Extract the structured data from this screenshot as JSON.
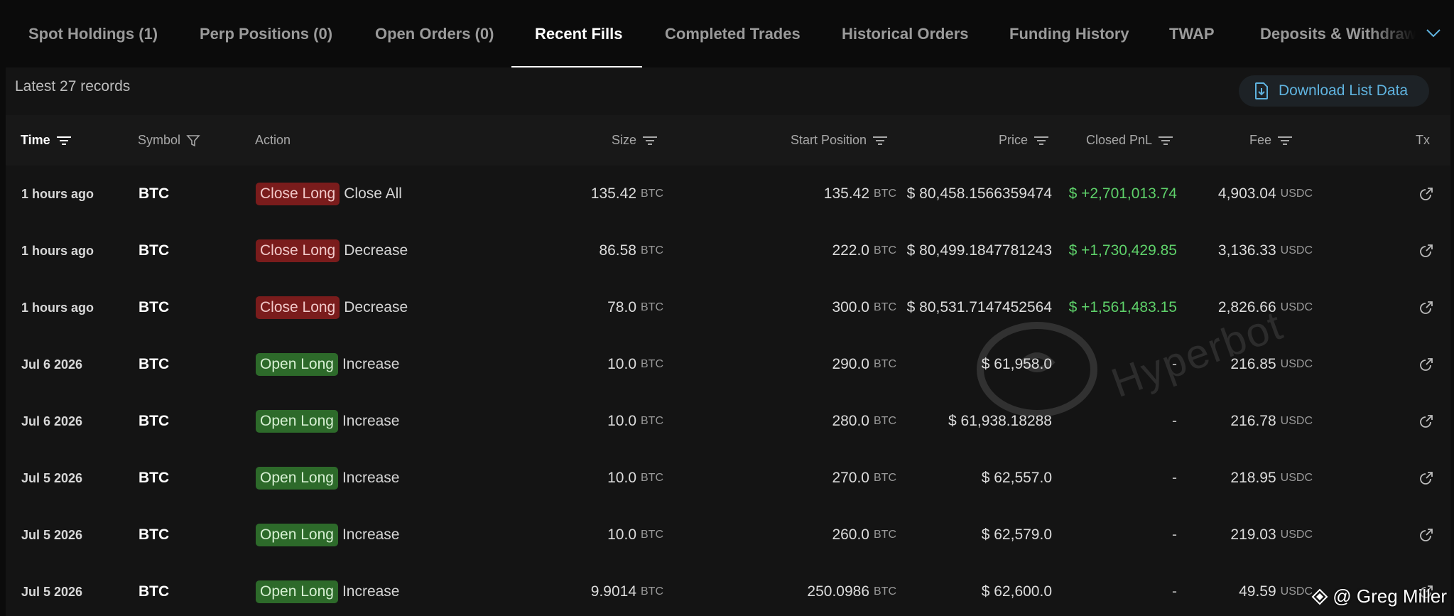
{
  "tabs": [
    {
      "label": "Spot Holdings (1)",
      "active": false
    },
    {
      "label": "Perp Positions (0)",
      "active": false
    },
    {
      "label": "Open Orders (0)",
      "active": false
    },
    {
      "label": "Recent Fills",
      "active": true
    },
    {
      "label": "Completed Trades",
      "active": false
    },
    {
      "label": "Historical Orders",
      "active": false
    },
    {
      "label": "Funding History",
      "active": false
    },
    {
      "label": "TWAP",
      "active": false
    },
    {
      "label": "Deposits & Withdraw",
      "active": false
    }
  ],
  "toolbar": {
    "records_text": "Latest 27 records",
    "download_label": "Download List Data"
  },
  "columns": {
    "time": "Time",
    "symbol": "Symbol",
    "action": "Action",
    "size": "Size",
    "start_position": "Start Position",
    "price": "Price",
    "closed_pnl": "Closed PnL",
    "fee": "Fee",
    "tx": "Tx"
  },
  "rows": [
    {
      "time": "1 hours ago",
      "symbol": "BTC",
      "action_badge": "Close Long",
      "action_type": "close",
      "action_detail": "Close All",
      "size": "135.42",
      "size_unit": "BTC",
      "start": "135.42",
      "start_unit": "BTC",
      "price": "$ 80,458.1566359474",
      "pnl": "$ +2,701,013.74",
      "pnl_positive": true,
      "fee": "4,903.04",
      "fee_unit": "USDC"
    },
    {
      "time": "1 hours ago",
      "symbol": "BTC",
      "action_badge": "Close Long",
      "action_type": "close",
      "action_detail": "Decrease",
      "size": "86.58",
      "size_unit": "BTC",
      "start": "222.0",
      "start_unit": "BTC",
      "price": "$ 80,499.1847781243",
      "pnl": "$ +1,730,429.85",
      "pnl_positive": true,
      "fee": "3,136.33",
      "fee_unit": "USDC"
    },
    {
      "time": "1 hours ago",
      "symbol": "BTC",
      "action_badge": "Close Long",
      "action_type": "close",
      "action_detail": "Decrease",
      "size": "78.0",
      "size_unit": "BTC",
      "start": "300.0",
      "start_unit": "BTC",
      "price": "$ 80,531.7147452564",
      "pnl": "$ +1,561,483.15",
      "pnl_positive": true,
      "fee": "2,826.66",
      "fee_unit": "USDC"
    },
    {
      "time": "Jul 6 2026",
      "symbol": "BTC",
      "action_badge": "Open Long",
      "action_type": "open",
      "action_detail": "Increase",
      "size": "10.0",
      "size_unit": "BTC",
      "start": "290.0",
      "start_unit": "BTC",
      "price": "$ 61,958.0",
      "pnl": "-",
      "pnl_positive": false,
      "fee": "216.85",
      "fee_unit": "USDC"
    },
    {
      "time": "Jul 6 2026",
      "symbol": "BTC",
      "action_badge": "Open Long",
      "action_type": "open",
      "action_detail": "Increase",
      "size": "10.0",
      "size_unit": "BTC",
      "start": "280.0",
      "start_unit": "BTC",
      "price": "$ 61,938.18288",
      "pnl": "-",
      "pnl_positive": false,
      "fee": "216.78",
      "fee_unit": "USDC"
    },
    {
      "time": "Jul 5 2026",
      "symbol": "BTC",
      "action_badge": "Open Long",
      "action_type": "open",
      "action_detail": "Increase",
      "size": "10.0",
      "size_unit": "BTC",
      "start": "270.0",
      "start_unit": "BTC",
      "price": "$ 62,557.0",
      "pnl": "-",
      "pnl_positive": false,
      "fee": "218.95",
      "fee_unit": "USDC"
    },
    {
      "time": "Jul 5 2026",
      "symbol": "BTC",
      "action_badge": "Open Long",
      "action_type": "open",
      "action_detail": "Increase",
      "size": "10.0",
      "size_unit": "BTC",
      "start": "260.0",
      "start_unit": "BTC",
      "price": "$ 62,579.0",
      "pnl": "-",
      "pnl_positive": false,
      "fee": "219.03",
      "fee_unit": "USDC"
    },
    {
      "time": "Jul 5 2026",
      "symbol": "BTC",
      "action_badge": "Open Long",
      "action_type": "open",
      "action_detail": "Increase",
      "size": "9.9014",
      "size_unit": "BTC",
      "start": "250.0986",
      "start_unit": "BTC",
      "price": "$ 62,600.0",
      "pnl": "-",
      "pnl_positive": false,
      "fee": "49.59",
      "fee_unit": "USDC"
    }
  ],
  "watermark": {
    "text": "Hyperbot"
  },
  "credit": {
    "text": "@ Greg Miller"
  },
  "icons": {
    "download": "download-file-icon",
    "sort": "sort-lines-icon",
    "filter": "funnel-filter-icon",
    "tx": "external-link-icon",
    "tabs_more": "chevron-down-icon"
  },
  "colors": {
    "background": "#0b0b0b",
    "panel": "#141414",
    "accent": "#5fb3df",
    "pnl_positive": "#5ed16a",
    "badge_close": "#7a1c1c",
    "badge_open": "#2d6a2a"
  }
}
